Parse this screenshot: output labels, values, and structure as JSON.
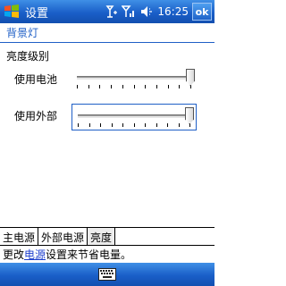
{
  "titlebar": {
    "title": "设置",
    "clock": "16:25",
    "ok_label": "ok"
  },
  "header": {
    "title": "背景灯"
  },
  "section": {
    "label": "亮度级别"
  },
  "sliders": [
    {
      "label": "使用电池",
      "level_fraction": 1.0,
      "tick_count": 11
    },
    {
      "label": "使用外部",
      "level_fraction": 1.0,
      "tick_count": 11
    }
  ],
  "tabs": [
    {
      "label": "主电源",
      "active": false
    },
    {
      "label": "外部电源",
      "active": false
    },
    {
      "label": "亮度",
      "active": true
    }
  ],
  "hint": {
    "prefix": "更改",
    "link": "电源",
    "suffix": "设置来节省电量。"
  },
  "colors": {
    "titlebar": "#1a5fc8",
    "header_text": "#1f5fc6",
    "link": "#1f3fcc"
  },
  "icons": [
    "windows-start-icon",
    "connectivity-icon",
    "signal-icon",
    "volume-icon",
    "keyboard-icon"
  ]
}
